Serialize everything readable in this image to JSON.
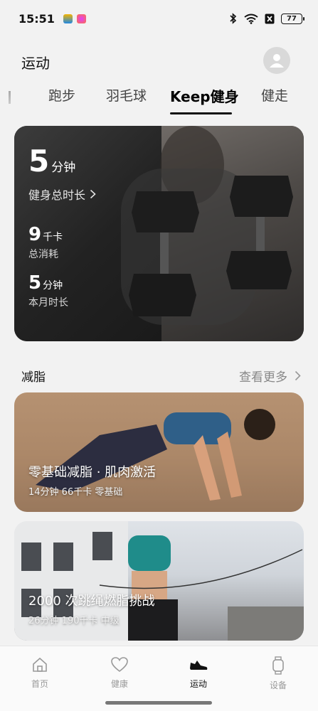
{
  "status_bar": {
    "time": "15:51",
    "battery": "77"
  },
  "header": {
    "title": "运动"
  },
  "tabs": [
    {
      "label": "跑步"
    },
    {
      "label": "羽毛球"
    },
    {
      "label": "Keep健身"
    },
    {
      "label": "健走"
    }
  ],
  "hero": {
    "total_duration_value": "5",
    "total_duration_unit": "分钟",
    "total_duration_label": "健身总时长",
    "calories_value": "9",
    "calories_unit": "千卡",
    "calories_label": "总消耗",
    "month_value": "5",
    "month_unit": "分钟",
    "month_label": "本月时长"
  },
  "section": {
    "title": "减脂",
    "see_more": "查看更多"
  },
  "workouts": [
    {
      "title": "零基础减脂 · 肌肉激活",
      "subtitle": "14分钟 66千卡 零基础"
    },
    {
      "title": "2000 次跳绳燃脂挑战",
      "subtitle": "26分钟 190千卡 中级"
    }
  ],
  "bottom_nav": [
    {
      "label": "首页"
    },
    {
      "label": "健康"
    },
    {
      "label": "运动"
    },
    {
      "label": "设备"
    }
  ]
}
